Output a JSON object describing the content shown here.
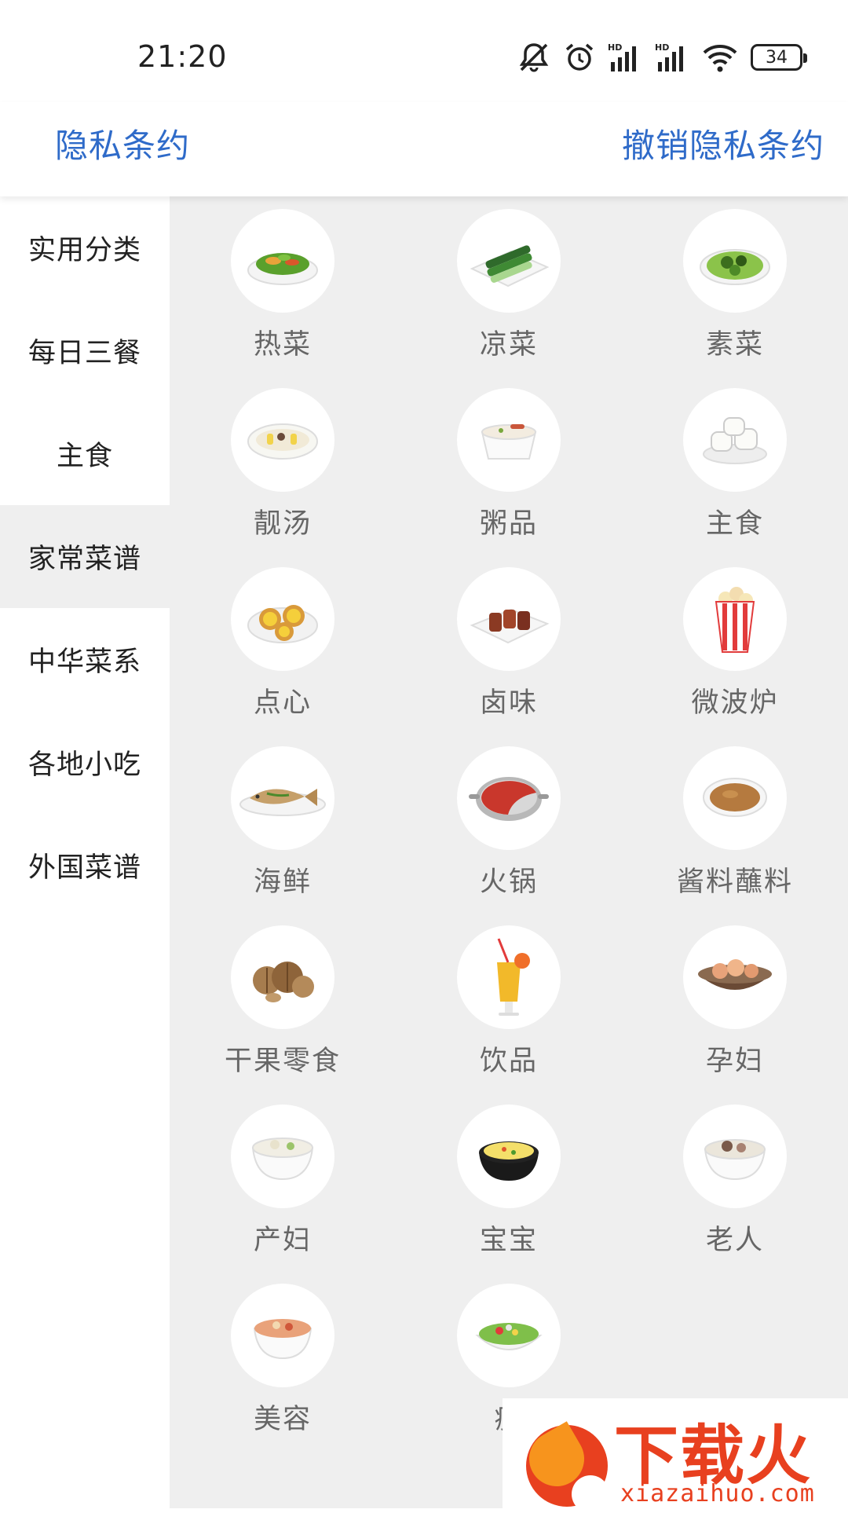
{
  "status_bar": {
    "time": "21:20",
    "battery": "34"
  },
  "header": {
    "left_link": "隐私条约",
    "right_link": "撤销隐私条约"
  },
  "sidebar": {
    "items": [
      {
        "label": "实用分类",
        "active": false
      },
      {
        "label": "每日三餐",
        "active": false
      },
      {
        "label": "主食",
        "active": false
      },
      {
        "label": "家常菜谱",
        "active": true
      },
      {
        "label": "中华菜系",
        "active": false
      },
      {
        "label": "各地小吃",
        "active": false
      },
      {
        "label": "外国菜谱",
        "active": false
      }
    ]
  },
  "grid": {
    "items": [
      {
        "label": "热菜",
        "icon": "stir-fry-dish-icon"
      },
      {
        "label": "凉菜",
        "icon": "cucumber-dish-icon"
      },
      {
        "label": "素菜",
        "icon": "vegetable-dish-icon"
      },
      {
        "label": "靓汤",
        "icon": "soup-bowl-icon"
      },
      {
        "label": "粥品",
        "icon": "congee-bowl-icon"
      },
      {
        "label": "主食",
        "icon": "steamed-buns-icon"
      },
      {
        "label": "点心",
        "icon": "egg-tart-icon"
      },
      {
        "label": "卤味",
        "icon": "braised-meat-icon"
      },
      {
        "label": "微波炉",
        "icon": "popcorn-icon"
      },
      {
        "label": "海鲜",
        "icon": "fish-dish-icon"
      },
      {
        "label": "火锅",
        "icon": "hotpot-icon"
      },
      {
        "label": "酱料蘸料",
        "icon": "sauce-bowl-icon"
      },
      {
        "label": "干果零食",
        "icon": "walnuts-icon"
      },
      {
        "label": "饮品",
        "icon": "juice-glass-icon"
      },
      {
        "label": "孕妇",
        "icon": "pregnant-meal-icon"
      },
      {
        "label": "产妇",
        "icon": "postpartum-soup-icon"
      },
      {
        "label": "宝宝",
        "icon": "steamed-egg-icon"
      },
      {
        "label": "老人",
        "icon": "elderly-soup-icon"
      },
      {
        "label": "美容",
        "icon": "beauty-soup-icon"
      },
      {
        "label": "瘦",
        "icon": "salad-icon"
      }
    ]
  },
  "watermark": {
    "title": "下载火",
    "url": "xiazaihuo.com"
  }
}
